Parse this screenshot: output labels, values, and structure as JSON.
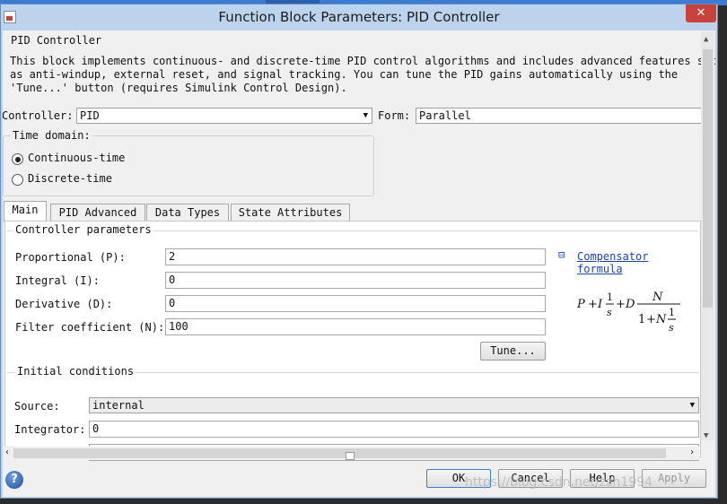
{
  "window": {
    "title": "Function Block Parameters: PID Controller",
    "close_glyph": "✕"
  },
  "description": {
    "title": "PID Controller",
    "text": "This block implements continuous- and discrete-time PID control algorithms and includes advanced features such\nas anti-windup, external reset, and signal tracking. You can tune the PID gains automatically using the\n'Tune...' button (requires Simulink Control Design)."
  },
  "controller": {
    "label": "Controller:",
    "value": "PID"
  },
  "form": {
    "label": "Form:",
    "value": "Parallel"
  },
  "time_domain": {
    "title": "Time domain:",
    "options": [
      "Continuous-time",
      "Discrete-time"
    ],
    "selected": "Continuous-time"
  },
  "tabs": [
    "Main",
    "PID Advanced",
    "Data Types",
    "State Attributes"
  ],
  "active_tab": "Main",
  "controller_params": {
    "title": "Controller parameters",
    "fields": [
      {
        "label": "Proportional (P):",
        "value": "2"
      },
      {
        "label": "Integral (I):",
        "value": "0"
      },
      {
        "label": "Derivative (D):",
        "value": "0"
      },
      {
        "label": "Filter coefficient (N):",
        "value": "100"
      }
    ],
    "compensator_toggle": "⊟",
    "compensator_link": "Compensator formula",
    "tune_button": "Tune..."
  },
  "initial_conditions": {
    "title": "Initial conditions",
    "source_label": "Source:",
    "source_value": "internal",
    "integrator_label": "Integrator:",
    "integrator_value": "0"
  },
  "buttons": {
    "ok": "OK",
    "cancel": "Cancel",
    "help": "Help",
    "apply": "Apply"
  },
  "help_icon_glyph": "?",
  "watermark": "https://blog.csdn.net/zzh1994"
}
